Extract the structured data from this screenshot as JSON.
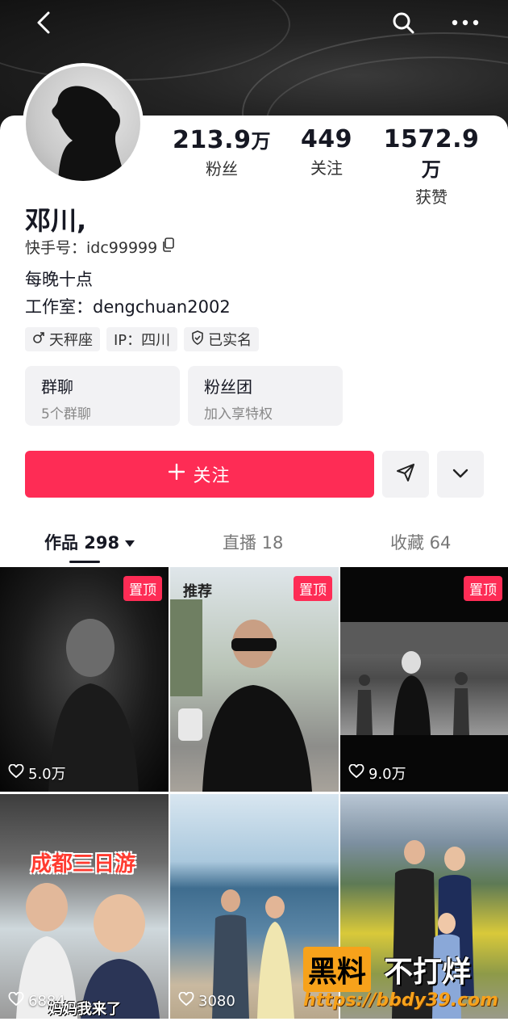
{
  "profile": {
    "name": "邓川,",
    "kuaishou_id_label": "快手号：idc99999",
    "bio_line1": "每晚十点",
    "bio_line2": "工作室：dengchuan2002"
  },
  "stats": [
    {
      "num": "213.9",
      "unit": "万",
      "label": "粉丝"
    },
    {
      "num": "449",
      "unit": "",
      "label": "关注"
    },
    {
      "num": "1572.9",
      "unit": "万",
      "label": "获赞"
    }
  ],
  "tags": [
    {
      "icon": "male-icon",
      "label": "天秤座"
    },
    {
      "icon": "",
      "label": "IP：四川"
    },
    {
      "icon": "verified-shield-icon",
      "label": "已实名"
    }
  ],
  "features": [
    {
      "title": "群聊",
      "sub": "5个群聊"
    },
    {
      "title": "粉丝团",
      "sub": "加入享特权"
    }
  ],
  "actions": {
    "follow_label": "关注"
  },
  "tabs": [
    {
      "label": "作品 298",
      "active": true
    },
    {
      "label": "直播 18",
      "active": false
    },
    {
      "label": "收藏 64",
      "active": false
    }
  ],
  "videos": [
    {
      "pinned": "置顶",
      "likes": "5.0万"
    },
    {
      "recommend": "推荐",
      "pinned": "置顶",
      "likes": ""
    },
    {
      "pinned": "置顶",
      "likes": "9.0万"
    },
    {
      "overlay": "成都三日游",
      "caption": "妈妈我来了",
      "likes": "6884"
    },
    {
      "likes": "3080"
    },
    {
      "likes": ""
    }
  ],
  "watermark": {
    "part1": "黑料",
    "part2": "不打烊",
    "url": "https://bbdy39.com"
  },
  "colors": {
    "accent": "#fe2c55",
    "watermark": "#f7a21b"
  }
}
